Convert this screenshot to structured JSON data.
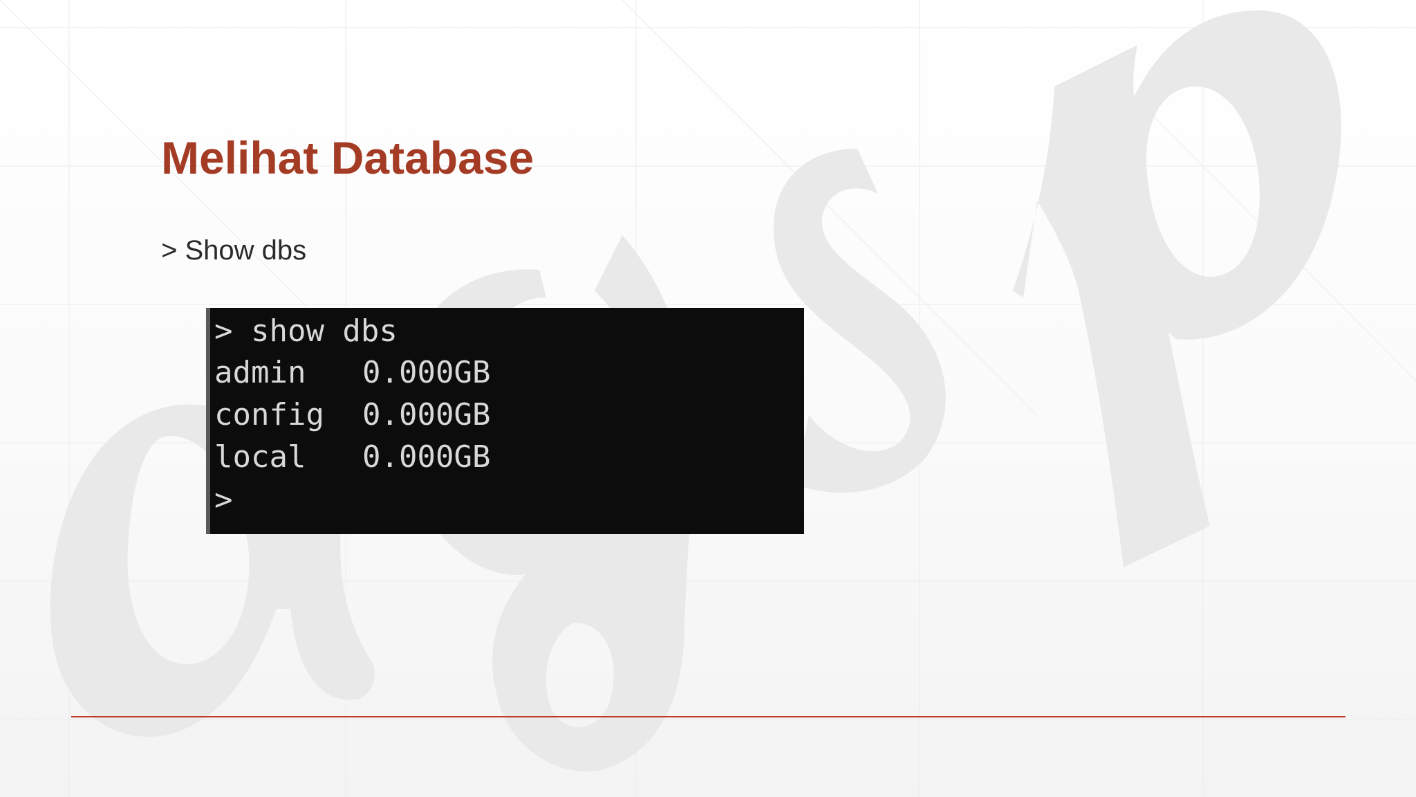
{
  "slide": {
    "title": "Melihat Database",
    "bullet": "> Show dbs",
    "colors": {
      "title": "#a43b24",
      "rule": "#c0392b",
      "terminal_bg": "#0c0c0c",
      "terminal_text": "#d8d8d8"
    }
  },
  "terminal": {
    "command": "> show dbs",
    "databases": [
      {
        "name": "admin",
        "size": "0.000GB"
      },
      {
        "name": "config",
        "size": "0.000GB"
      },
      {
        "name": "local",
        "size": "0.000GB"
      }
    ],
    "prompt": ">"
  }
}
